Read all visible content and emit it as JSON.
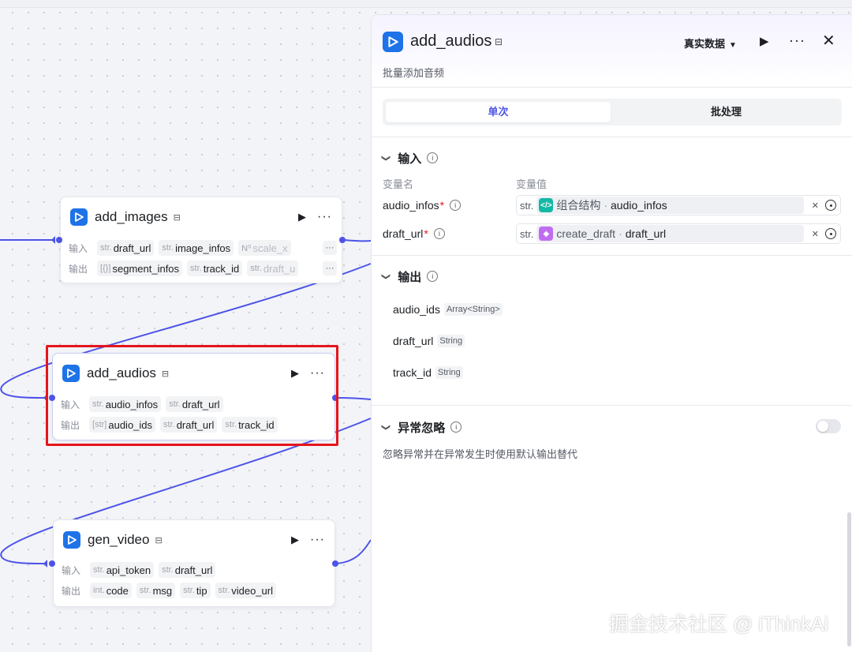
{
  "canvas": {
    "nodes": [
      {
        "title": "add_images",
        "input_label": "输入",
        "output_label": "输出",
        "inputs": [
          {
            "type": "str.",
            "name": "draft_url"
          },
          {
            "type": "str.",
            "name": "image_infos"
          },
          {
            "type": "N⁰",
            "name": "scale_x"
          }
        ],
        "outputs": [
          {
            "type": "[{}]",
            "name": "segment_infos"
          },
          {
            "type": "str.",
            "name": "track_id"
          },
          {
            "type": "str.",
            "name": "draft_u"
          }
        ],
        "more": "···"
      },
      {
        "title": "add_audios",
        "input_label": "输入",
        "output_label": "输出",
        "inputs": [
          {
            "type": "str.",
            "name": "audio_infos"
          },
          {
            "type": "str.",
            "name": "draft_url"
          }
        ],
        "outputs": [
          {
            "type": "[str]",
            "name": "audio_ids"
          },
          {
            "type": "str.",
            "name": "draft_url"
          },
          {
            "type": "str.",
            "name": "track_id"
          }
        ]
      },
      {
        "title": "gen_video",
        "input_label": "输入",
        "output_label": "输出",
        "inputs": [
          {
            "type": "str.",
            "name": "api_token"
          },
          {
            "type": "str.",
            "name": "draft_url"
          }
        ],
        "outputs": [
          {
            "type": "int.",
            "name": "code"
          },
          {
            "type": "str.",
            "name": "msg"
          },
          {
            "type": "str.",
            "name": "tip"
          },
          {
            "type": "str.",
            "name": "video_url"
          }
        ]
      }
    ]
  },
  "panel": {
    "title": "add_audios",
    "description": "批量添加音频",
    "mode": "真实数据",
    "tabs": {
      "single": "单次",
      "batch": "批处理"
    },
    "input_section": {
      "title": "输入",
      "col_name": "变量名",
      "col_value": "变量值",
      "rows": [
        {
          "name": "audio_infos",
          "required": "*",
          "type": "str.",
          "source": "组合结构",
          "field": "audio_infos"
        },
        {
          "name": "draft_url",
          "required": "*",
          "type": "str.",
          "source": "create_draft",
          "field": "draft_url"
        }
      ]
    },
    "output_section": {
      "title": "输出",
      "rows": [
        {
          "name": "audio_ids",
          "type": "Array<String>"
        },
        {
          "name": "draft_url",
          "type": "String"
        },
        {
          "name": "track_id",
          "type": "String"
        }
      ]
    },
    "exception_section": {
      "title": "异常忽略",
      "description": "忽略异常并在异常发生时使用默认输出替代",
      "enabled": false
    }
  },
  "watermark": "掘金技术社区 @ iThinkAi",
  "colors": {
    "accent": "#4d53e8",
    "brand": "#1e73e8",
    "highlight": "#e5151c"
  }
}
